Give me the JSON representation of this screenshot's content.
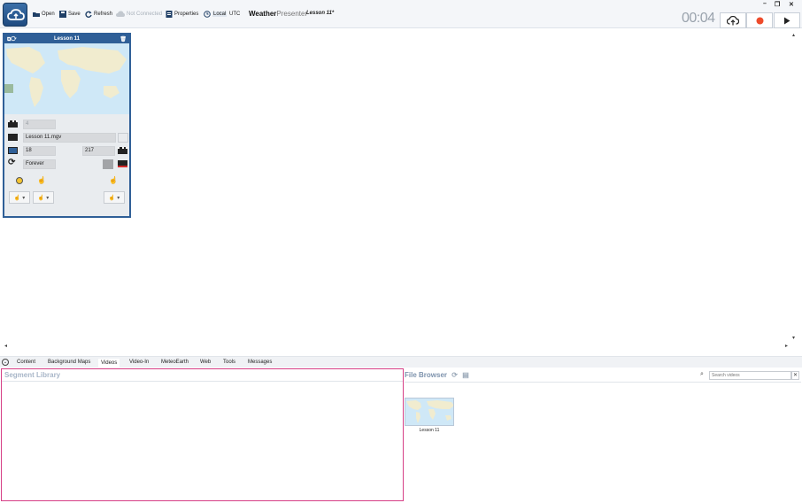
{
  "toolbar": {
    "open": "Open",
    "save": "Save",
    "refresh": "Refresh",
    "not_connected": "Not Connected",
    "properties": "Properties",
    "local": "Local",
    "utc": "UTC",
    "brand_bold": "Weather",
    "brand_light": "Presenter",
    "lesson_title": "Lesson 11*",
    "timer": "00:04"
  },
  "segment": {
    "title": "Lesson 11",
    "frame_field": "4",
    "file_name": "Lesson 11.mgv",
    "start_frame": "18",
    "end_frame": "217",
    "loop_mode": "Forever"
  },
  "tabs": [
    {
      "label": "Content"
    },
    {
      "label": "Background Maps"
    },
    {
      "label": "Videos"
    },
    {
      "label": "Video-In"
    },
    {
      "label": "MeteoEarth"
    },
    {
      "label": "Web"
    },
    {
      "label": "Tools"
    },
    {
      "label": "Messages"
    }
  ],
  "segment_library": {
    "title": "Segment Library"
  },
  "file_browser": {
    "title": "File Browser",
    "search_placeholder": "Search videos",
    "items": [
      {
        "label": "Lesson 11"
      }
    ]
  },
  "colors": {
    "accent": "#2f5f97",
    "library_border": "#d63f86",
    "record": "#ee4b2b"
  }
}
